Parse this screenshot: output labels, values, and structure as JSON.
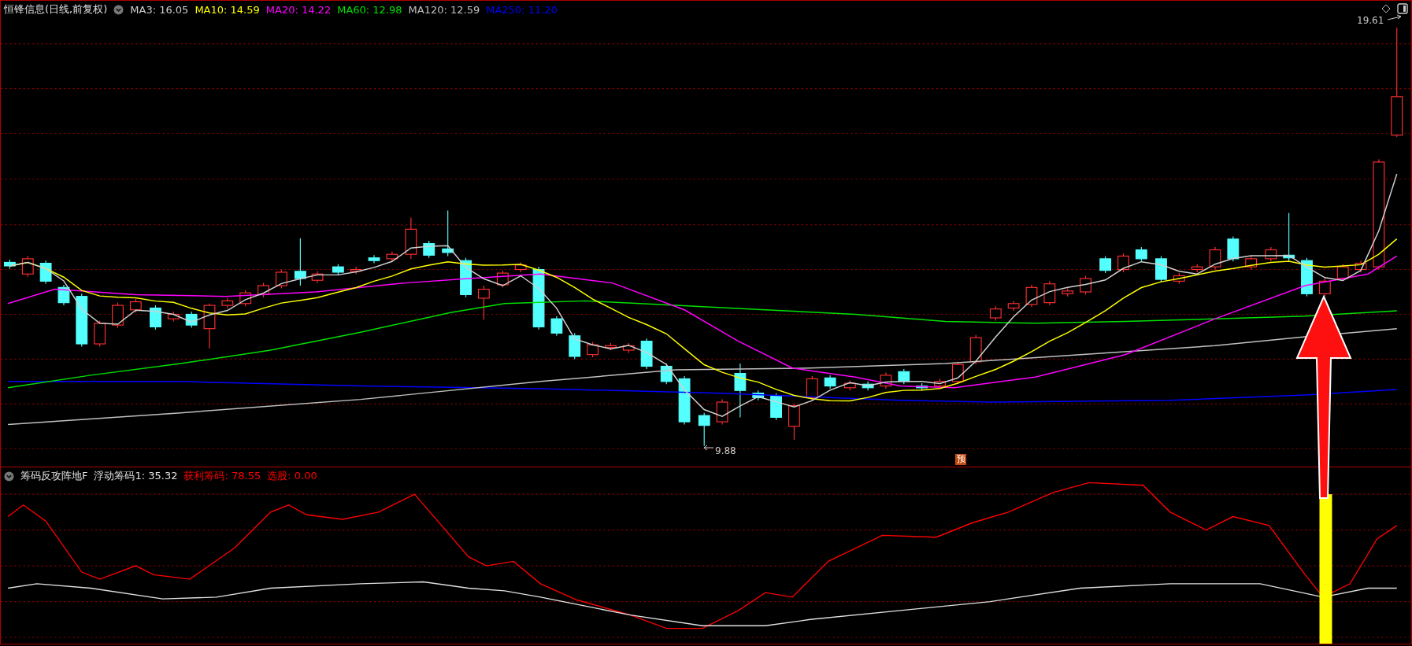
{
  "main_pane": {
    "title": "恒锋信息(日线,前复权)",
    "indicators": [
      {
        "label": "MA3: 16.05",
        "color": "#d0d0d0"
      },
      {
        "label": "MA10: 14.59",
        "color": "#ffff00"
      },
      {
        "label": "MA20: 14.22",
        "color": "#ff00ff"
      },
      {
        "label": "MA60: 12.98",
        "color": "#00e000"
      },
      {
        "label": "MA120: 12.59",
        "color": "#c0c0c0"
      },
      {
        "label": "MA250: 11.20",
        "color": "#0000ff"
      }
    ],
    "high_label": "19.61",
    "low_label": "9.88",
    "forecast_marker": "预"
  },
  "sub_pane": {
    "title": "筹码反攻阵地F",
    "indicators": [
      {
        "label": "浮动筹码1: 35.32",
        "color": "#e0e0e0"
      },
      {
        "label": "获利筹码: 78.55",
        "color": "#ff0000"
      },
      {
        "label": "选股: 0.00",
        "color": "#ff0000"
      }
    ]
  }
}
